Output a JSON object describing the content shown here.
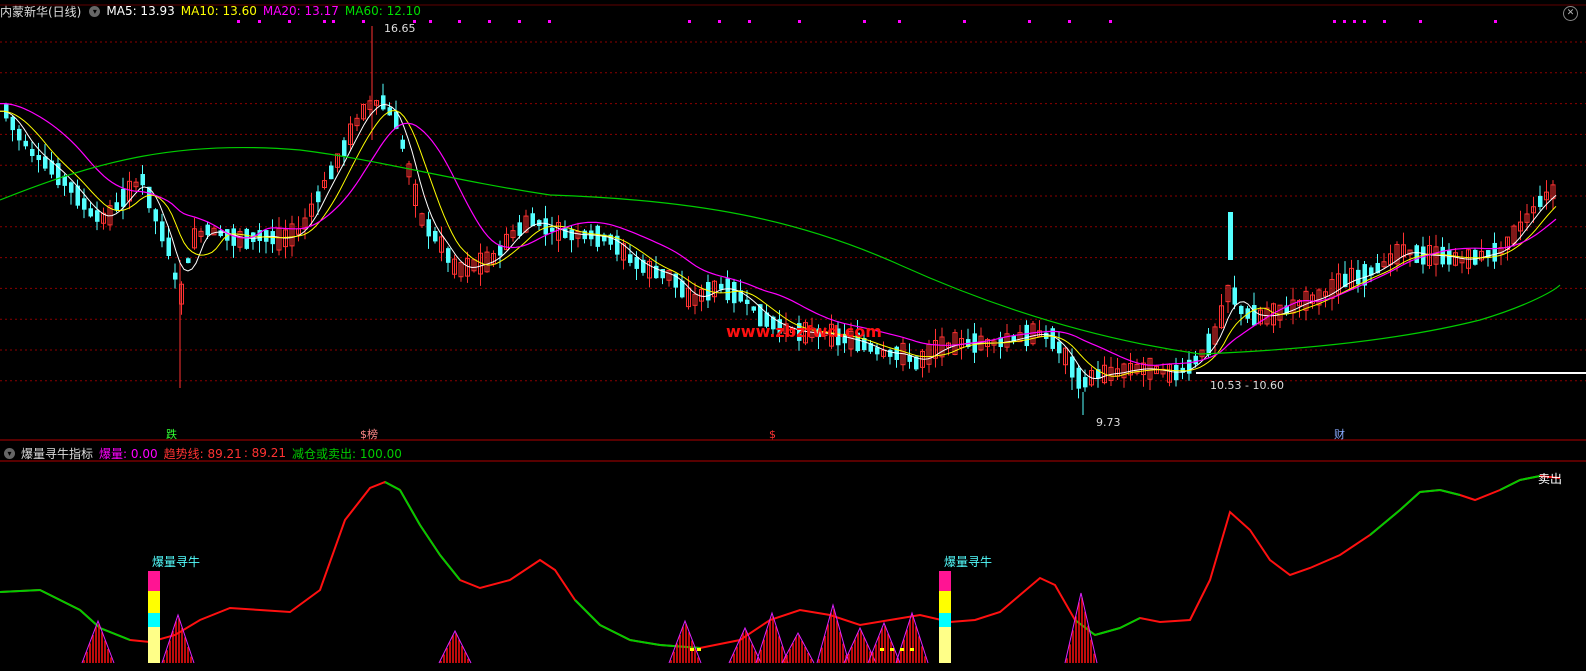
{
  "main_header": {
    "title": "内蒙新华(日线)",
    "ma5": "MA5: 13.93",
    "ma10": "MA10: 13.60",
    "ma20": "MA20: 13.17",
    "ma60": "MA60: 12.10"
  },
  "colors": {
    "up": "#ff3232",
    "down": "#54ffff",
    "ma5": "#ffffff",
    "ma10": "#ffff00",
    "ma20": "#ff00ff",
    "ma60": "#00cc00",
    "grid": "#8b0000"
  },
  "price_labels": {
    "high": "16.65",
    "low": "9.73",
    "range": "10.53 - 10.60"
  },
  "watermark": "www.zbzfwd.com",
  "event_tags": [
    {
      "label": "跌",
      "color": "#33ff33"
    },
    {
      "label": "$榜",
      "color": "#ff8888"
    },
    {
      "label": "$",
      "color": "#ff3333"
    },
    {
      "label": "财",
      "color": "#88aaff"
    }
  ],
  "indicator_header": {
    "title": "爆量寻牛指标",
    "burst": "爆量: 0.00",
    "trend": "趋势线: 89.21",
    "trend_extra": ": 89.21",
    "reduce": "减仓或卖出: 100.00"
  },
  "indicator_labels": {
    "signal": "爆量寻牛",
    "sell": "卖出"
  },
  "icons": {
    "settings": "circle-toggle-icon",
    "close": "close-icon"
  }
}
